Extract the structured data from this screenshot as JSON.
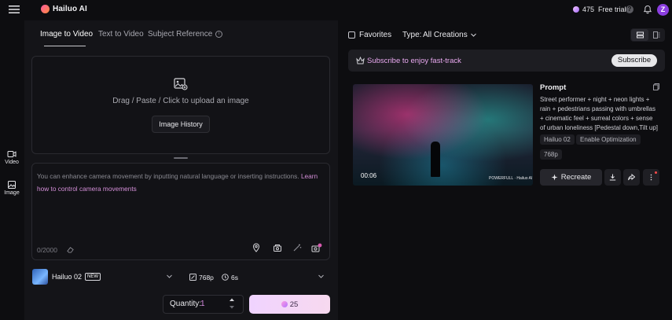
{
  "header": {
    "logo_text": "Hailuo AI",
    "credits": "475",
    "free_trial": "Free trial",
    "help_glyph": "?",
    "avatar_letter": "Z"
  },
  "rail": {
    "video_label": "Video",
    "image_label": "Image"
  },
  "tabs": [
    {
      "label": "Image to Video"
    },
    {
      "label": "Text to Video"
    },
    {
      "label": "Subject Reference"
    }
  ],
  "upload": {
    "text": "Drag / Paste / Click to upload an image",
    "history_button": "Image History"
  },
  "prompt": {
    "placeholder": "You can enhance camera movement by inputting natural language or inserting instructions.",
    "learn_link": "Learn how to control camera movements",
    "char_count": "0/2000"
  },
  "model": {
    "name": "Hailuo 02",
    "badge": "NEW",
    "resolution": "768p",
    "duration": "6s"
  },
  "quantity": {
    "label": "Quantity:",
    "value": "1"
  },
  "generate": {
    "credits": "25"
  },
  "filters": {
    "favorites": "Favorites",
    "type_label": "Type:",
    "type_value": "All Creations"
  },
  "banner": {
    "text": "Subscribe to enjoy fast-track",
    "button": "Subscribe"
  },
  "creation": {
    "time": "00:06",
    "watermark": "POWERFULL · Hailuo AI",
    "prompt_title": "Prompt",
    "prompt_text": "Street performer + night + neon lights + rain + pedestrians passing with umbrellas + cinematic feel + surreal colors + sense of urban loneliness [Pedestal down,Tilt up]",
    "model_chip": "Hailuo 02",
    "optimization_chip": "Enable Optimization",
    "resolution_chip": "768p",
    "recreate": "Recreate"
  },
  "colors": {
    "accent_pink": "#d48fd8",
    "generate_bg": "#f0d3ff",
    "background": "#0d0d10"
  }
}
